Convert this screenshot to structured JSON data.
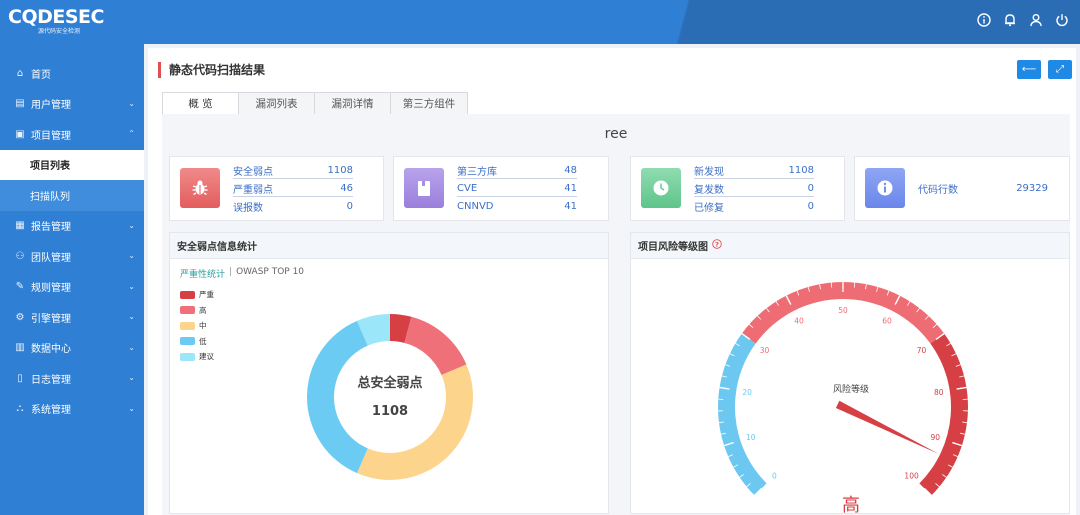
{
  "header": {
    "logo_text": "CQDESEC",
    "logo_sub": "源代码安全检测",
    "icons": [
      "info-icon",
      "bell-icon",
      "user-icon",
      "power-icon"
    ]
  },
  "sidebar": {
    "items": [
      {
        "label": "首页",
        "icon": "home-icon"
      },
      {
        "label": "用户管理",
        "icon": "user-manage-icon"
      },
      {
        "label": "项目管理",
        "icon": "project-icon",
        "expanded": true
      },
      {
        "label": "报告管理",
        "icon": "report-icon"
      },
      {
        "label": "团队管理",
        "icon": "team-icon"
      },
      {
        "label": "规则管理",
        "icon": "rule-icon"
      },
      {
        "label": "引擎管理",
        "icon": "engine-icon"
      },
      {
        "label": "数据中心",
        "icon": "data-icon"
      },
      {
        "label": "日志管理",
        "icon": "log-icon"
      },
      {
        "label": "系统管理",
        "icon": "system-icon"
      }
    ],
    "subitems": [
      {
        "label": "项目列表",
        "active": true
      },
      {
        "label": "扫描队列",
        "active": false
      }
    ]
  },
  "page": {
    "title": "静态代码扫描结果",
    "tabs": [
      "概 览",
      "漏洞列表",
      "漏洞详情",
      "第三方组件"
    ],
    "project_name": "ree"
  },
  "cards": [
    {
      "icon": "bug-icon",
      "color": "#e86b6b",
      "rows": [
        {
          "label": "安全弱点",
          "value": "1108"
        },
        {
          "label": "严重弱点",
          "value": "46"
        },
        {
          "label": "误报数",
          "value": "0"
        }
      ]
    },
    {
      "icon": "file-icon",
      "color": "#a88fe0",
      "rows": [
        {
          "label": "第三方库",
          "value": "48"
        },
        {
          "label": "CVE",
          "value": "41"
        },
        {
          "label": "CNNVD",
          "value": "41"
        }
      ]
    },
    {
      "icon": "clock-icon",
      "color": "#6cc995",
      "rows": [
        {
          "label": "新发现",
          "value": "1108"
        },
        {
          "label": "复发数",
          "value": "0"
        },
        {
          "label": "已修复",
          "value": "0"
        }
      ]
    },
    {
      "icon": "info-circle-icon",
      "color": "#6e8ef0",
      "rows": [
        {
          "label": "代码行数",
          "value": "29329"
        }
      ]
    }
  ],
  "weakness_stats": {
    "title": "安全弱点信息统计",
    "subtabs": [
      "严重性统计",
      "OWASP TOP 10"
    ],
    "center_label": "总安全弱点",
    "center_value": "1108"
  },
  "risk_gauge": {
    "title": "项目风险等级图",
    "label": "风险等级",
    "level": "高",
    "ticks": [
      "0",
      "10",
      "20",
      "30",
      "40",
      "50",
      "60",
      "70",
      "80",
      "90",
      "100"
    ],
    "value": 93,
    "colors": {
      "low": "#6cc8f0",
      "mid": "#ee6d75",
      "high": "#d64045"
    }
  },
  "chart_data": {
    "type": "pie",
    "categories": [
      "严重",
      "高",
      "中",
      "低",
      "建议"
    ],
    "values": [
      46,
      160,
      420,
      410,
      72
    ],
    "colors": [
      "#d64045",
      "#f07079",
      "#fdd48c",
      "#6ccbf2",
      "#9be6f8"
    ],
    "legend": "top-left"
  }
}
